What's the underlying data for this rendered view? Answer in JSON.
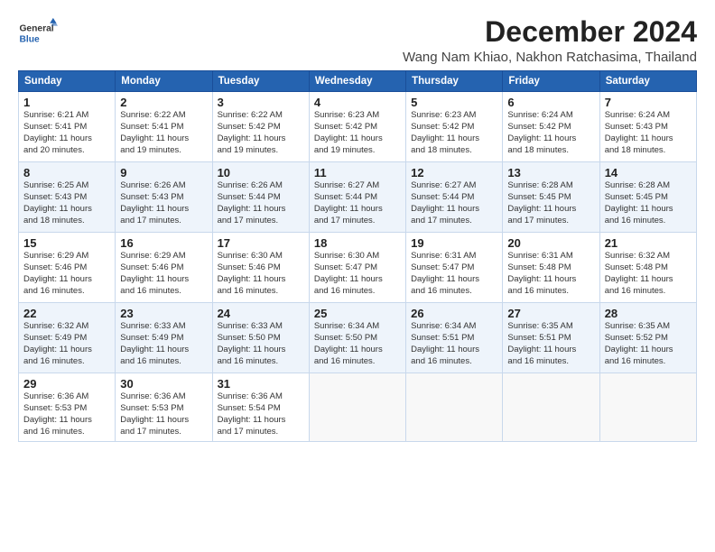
{
  "logo": {
    "line1": "General",
    "line2": "Blue"
  },
  "title": "December 2024",
  "location": "Wang Nam Khiao, Nakhon Ratchasima, Thailand",
  "days_of_week": [
    "Sunday",
    "Monday",
    "Tuesday",
    "Wednesday",
    "Thursday",
    "Friday",
    "Saturday"
  ],
  "weeks": [
    [
      {
        "day": "1",
        "info": "Sunrise: 6:21 AM\nSunset: 5:41 PM\nDaylight: 11 hours\nand 20 minutes."
      },
      {
        "day": "2",
        "info": "Sunrise: 6:22 AM\nSunset: 5:41 PM\nDaylight: 11 hours\nand 19 minutes."
      },
      {
        "day": "3",
        "info": "Sunrise: 6:22 AM\nSunset: 5:42 PM\nDaylight: 11 hours\nand 19 minutes."
      },
      {
        "day": "4",
        "info": "Sunrise: 6:23 AM\nSunset: 5:42 PM\nDaylight: 11 hours\nand 19 minutes."
      },
      {
        "day": "5",
        "info": "Sunrise: 6:23 AM\nSunset: 5:42 PM\nDaylight: 11 hours\nand 18 minutes."
      },
      {
        "day": "6",
        "info": "Sunrise: 6:24 AM\nSunset: 5:42 PM\nDaylight: 11 hours\nand 18 minutes."
      },
      {
        "day": "7",
        "info": "Sunrise: 6:24 AM\nSunset: 5:43 PM\nDaylight: 11 hours\nand 18 minutes."
      }
    ],
    [
      {
        "day": "8",
        "info": "Sunrise: 6:25 AM\nSunset: 5:43 PM\nDaylight: 11 hours\nand 18 minutes."
      },
      {
        "day": "9",
        "info": "Sunrise: 6:26 AM\nSunset: 5:43 PM\nDaylight: 11 hours\nand 17 minutes."
      },
      {
        "day": "10",
        "info": "Sunrise: 6:26 AM\nSunset: 5:44 PM\nDaylight: 11 hours\nand 17 minutes."
      },
      {
        "day": "11",
        "info": "Sunrise: 6:27 AM\nSunset: 5:44 PM\nDaylight: 11 hours\nand 17 minutes."
      },
      {
        "day": "12",
        "info": "Sunrise: 6:27 AM\nSunset: 5:44 PM\nDaylight: 11 hours\nand 17 minutes."
      },
      {
        "day": "13",
        "info": "Sunrise: 6:28 AM\nSunset: 5:45 PM\nDaylight: 11 hours\nand 17 minutes."
      },
      {
        "day": "14",
        "info": "Sunrise: 6:28 AM\nSunset: 5:45 PM\nDaylight: 11 hours\nand 16 minutes."
      }
    ],
    [
      {
        "day": "15",
        "info": "Sunrise: 6:29 AM\nSunset: 5:46 PM\nDaylight: 11 hours\nand 16 minutes."
      },
      {
        "day": "16",
        "info": "Sunrise: 6:29 AM\nSunset: 5:46 PM\nDaylight: 11 hours\nand 16 minutes."
      },
      {
        "day": "17",
        "info": "Sunrise: 6:30 AM\nSunset: 5:46 PM\nDaylight: 11 hours\nand 16 minutes."
      },
      {
        "day": "18",
        "info": "Sunrise: 6:30 AM\nSunset: 5:47 PM\nDaylight: 11 hours\nand 16 minutes."
      },
      {
        "day": "19",
        "info": "Sunrise: 6:31 AM\nSunset: 5:47 PM\nDaylight: 11 hours\nand 16 minutes."
      },
      {
        "day": "20",
        "info": "Sunrise: 6:31 AM\nSunset: 5:48 PM\nDaylight: 11 hours\nand 16 minutes."
      },
      {
        "day": "21",
        "info": "Sunrise: 6:32 AM\nSunset: 5:48 PM\nDaylight: 11 hours\nand 16 minutes."
      }
    ],
    [
      {
        "day": "22",
        "info": "Sunrise: 6:32 AM\nSunset: 5:49 PM\nDaylight: 11 hours\nand 16 minutes."
      },
      {
        "day": "23",
        "info": "Sunrise: 6:33 AM\nSunset: 5:49 PM\nDaylight: 11 hours\nand 16 minutes."
      },
      {
        "day": "24",
        "info": "Sunrise: 6:33 AM\nSunset: 5:50 PM\nDaylight: 11 hours\nand 16 minutes."
      },
      {
        "day": "25",
        "info": "Sunrise: 6:34 AM\nSunset: 5:50 PM\nDaylight: 11 hours\nand 16 minutes."
      },
      {
        "day": "26",
        "info": "Sunrise: 6:34 AM\nSunset: 5:51 PM\nDaylight: 11 hours\nand 16 minutes."
      },
      {
        "day": "27",
        "info": "Sunrise: 6:35 AM\nSunset: 5:51 PM\nDaylight: 11 hours\nand 16 minutes."
      },
      {
        "day": "28",
        "info": "Sunrise: 6:35 AM\nSunset: 5:52 PM\nDaylight: 11 hours\nand 16 minutes."
      }
    ],
    [
      {
        "day": "29",
        "info": "Sunrise: 6:36 AM\nSunset: 5:53 PM\nDaylight: 11 hours\nand 16 minutes."
      },
      {
        "day": "30",
        "info": "Sunrise: 6:36 AM\nSunset: 5:53 PM\nDaylight: 11 hours\nand 17 minutes."
      },
      {
        "day": "31",
        "info": "Sunrise: 6:36 AM\nSunset: 5:54 PM\nDaylight: 11 hours\nand 17 minutes."
      },
      {
        "day": "",
        "info": ""
      },
      {
        "day": "",
        "info": ""
      },
      {
        "day": "",
        "info": ""
      },
      {
        "day": "",
        "info": ""
      }
    ]
  ]
}
